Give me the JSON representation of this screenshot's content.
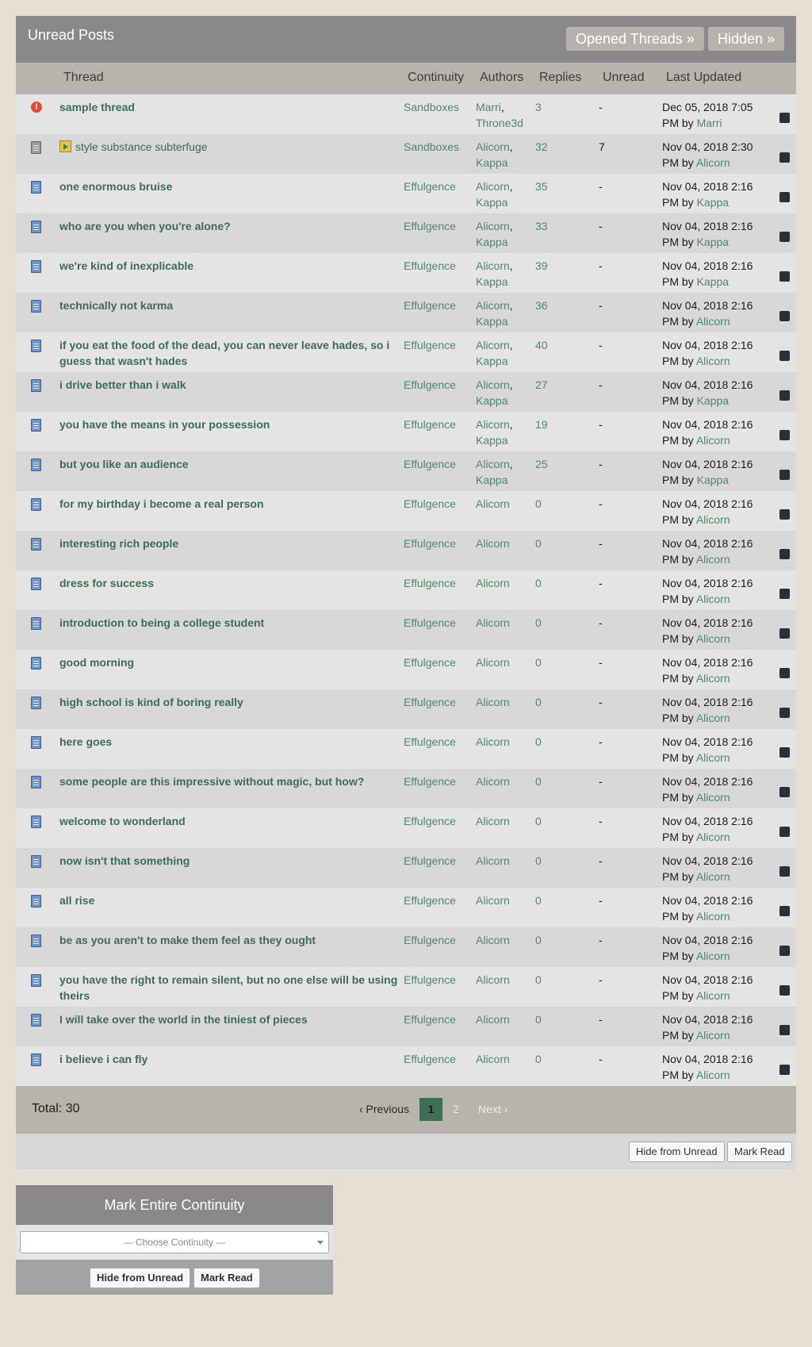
{
  "header": {
    "title": "Unread Posts",
    "opened_threads_label": "Opened Threads »",
    "hidden_label": "Hidden »"
  },
  "columns": {
    "thread": "Thread",
    "continuity": "Continuity",
    "authors": "Authors",
    "replies": "Replies",
    "unread": "Unread",
    "last_updated": "Last Updated"
  },
  "rows": [
    {
      "icon": "alert-icon",
      "title": "sample thread",
      "continuity": "Sandboxes",
      "authors": [
        "Marri",
        "Throne3d"
      ],
      "replies": "3",
      "unread": "-",
      "updated": "Dec 05, 2018 7:05 PM by",
      "by": "Marri"
    },
    {
      "icon": "grey-book-icon",
      "title": "style substance subterfuge",
      "plain": true,
      "reply_icon": true,
      "continuity": "Sandboxes",
      "authors": [
        "Alicorn",
        "Kappa"
      ],
      "replies": "32",
      "unread": "7",
      "updated": "Nov 04, 2018 2:30 PM by",
      "by": "Alicorn"
    },
    {
      "icon": "book-icon",
      "title": "one enormous bruise",
      "continuity": "Effulgence",
      "authors": [
        "Alicorn",
        "Kappa"
      ],
      "replies": "35",
      "unread": "-",
      "updated": "Nov 04, 2018 2:16 PM by",
      "by": "Kappa"
    },
    {
      "icon": "book-icon",
      "title": "who are you when you're alone?",
      "continuity": "Effulgence",
      "authors": [
        "Alicorn",
        "Kappa"
      ],
      "replies": "33",
      "unread": "-",
      "updated": "Nov 04, 2018 2:16 PM by",
      "by": "Kappa"
    },
    {
      "icon": "book-icon",
      "title": "we're kind of inexplicable",
      "continuity": "Effulgence",
      "authors": [
        "Alicorn",
        "Kappa"
      ],
      "replies": "39",
      "unread": "-",
      "updated": "Nov 04, 2018 2:16 PM by",
      "by": "Kappa"
    },
    {
      "icon": "book-icon",
      "title": "technically not karma",
      "continuity": "Effulgence",
      "authors": [
        "Alicorn",
        "Kappa"
      ],
      "replies": "36",
      "unread": "-",
      "updated": "Nov 04, 2018 2:16 PM by",
      "by": "Alicorn"
    },
    {
      "icon": "book-icon",
      "title": "if you eat the food of the dead, you can never leave hades, so i guess that wasn't hades",
      "continuity": "Effulgence",
      "authors": [
        "Alicorn",
        "Kappa"
      ],
      "replies": "40",
      "unread": "-",
      "updated": "Nov 04, 2018 2:16 PM by",
      "by": "Alicorn"
    },
    {
      "icon": "book-icon",
      "title": "i drive better than i walk",
      "continuity": "Effulgence",
      "authors": [
        "Alicorn",
        "Kappa"
      ],
      "replies": "27",
      "unread": "-",
      "updated": "Nov 04, 2018 2:16 PM by",
      "by": "Kappa"
    },
    {
      "icon": "book-icon",
      "title": "you have the means in your possession",
      "continuity": "Effulgence",
      "authors": [
        "Alicorn",
        "Kappa"
      ],
      "replies": "19",
      "unread": "-",
      "updated": "Nov 04, 2018 2:16 PM by",
      "by": "Alicorn"
    },
    {
      "icon": "book-icon",
      "title": "but you like an audience",
      "continuity": "Effulgence",
      "authors": [
        "Alicorn",
        "Kappa"
      ],
      "replies": "25",
      "unread": "-",
      "updated": "Nov 04, 2018 2:16 PM by",
      "by": "Kappa"
    },
    {
      "icon": "book-icon",
      "title": "for my birthday i become a real person",
      "continuity": "Effulgence",
      "authors": [
        "Alicorn"
      ],
      "replies": "0",
      "unread": "-",
      "updated": "Nov 04, 2018 2:16 PM by",
      "by": "Alicorn"
    },
    {
      "icon": "book-icon",
      "title": "interesting rich people",
      "continuity": "Effulgence",
      "authors": [
        "Alicorn"
      ],
      "replies": "0",
      "unread": "-",
      "updated": "Nov 04, 2018 2:16 PM by",
      "by": "Alicorn"
    },
    {
      "icon": "book-icon",
      "title": "dress for success",
      "continuity": "Effulgence",
      "authors": [
        "Alicorn"
      ],
      "replies": "0",
      "unread": "-",
      "updated": "Nov 04, 2018 2:16 PM by",
      "by": "Alicorn"
    },
    {
      "icon": "book-icon",
      "title": "introduction to being a college student",
      "continuity": "Effulgence",
      "authors": [
        "Alicorn"
      ],
      "replies": "0",
      "unread": "-",
      "updated": "Nov 04, 2018 2:16 PM by",
      "by": "Alicorn"
    },
    {
      "icon": "book-icon",
      "title": "good morning",
      "continuity": "Effulgence",
      "authors": [
        "Alicorn"
      ],
      "replies": "0",
      "unread": "-",
      "updated": "Nov 04, 2018 2:16 PM by",
      "by": "Alicorn"
    },
    {
      "icon": "book-icon",
      "title": "high school is kind of boring really",
      "continuity": "Effulgence",
      "authors": [
        "Alicorn"
      ],
      "replies": "0",
      "unread": "-",
      "updated": "Nov 04, 2018 2:16 PM by",
      "by": "Alicorn"
    },
    {
      "icon": "book-icon",
      "title": "here goes",
      "continuity": "Effulgence",
      "authors": [
        "Alicorn"
      ],
      "replies": "0",
      "unread": "-",
      "updated": "Nov 04, 2018 2:16 PM by",
      "by": "Alicorn"
    },
    {
      "icon": "book-icon",
      "title": "some people are this impressive without magic, but how?",
      "continuity": "Effulgence",
      "authors": [
        "Alicorn"
      ],
      "replies": "0",
      "unread": "-",
      "updated": "Nov 04, 2018 2:16 PM by",
      "by": "Alicorn"
    },
    {
      "icon": "book-icon",
      "title": "welcome to wonderland",
      "continuity": "Effulgence",
      "authors": [
        "Alicorn"
      ],
      "replies": "0",
      "unread": "-",
      "updated": "Nov 04, 2018 2:16 PM by",
      "by": "Alicorn"
    },
    {
      "icon": "book-icon",
      "title": "now isn't that something",
      "continuity": "Effulgence",
      "authors": [
        "Alicorn"
      ],
      "replies": "0",
      "unread": "-",
      "updated": "Nov 04, 2018 2:16 PM by",
      "by": "Alicorn"
    },
    {
      "icon": "book-icon",
      "title": "all rise",
      "continuity": "Effulgence",
      "authors": [
        "Alicorn"
      ],
      "replies": "0",
      "unread": "-",
      "updated": "Nov 04, 2018 2:16 PM by",
      "by": "Alicorn"
    },
    {
      "icon": "book-icon",
      "title": "be as you aren't to make them feel as they ought",
      "continuity": "Effulgence",
      "authors": [
        "Alicorn"
      ],
      "replies": "0",
      "unread": "-",
      "updated": "Nov 04, 2018 2:16 PM by",
      "by": "Alicorn"
    },
    {
      "icon": "book-icon",
      "title": "you have the right to remain silent, but no one else will be using theirs",
      "continuity": "Effulgence",
      "authors": [
        "Alicorn"
      ],
      "replies": "0",
      "unread": "-",
      "updated": "Nov 04, 2018 2:16 PM by",
      "by": "Alicorn"
    },
    {
      "icon": "book-icon",
      "title": "I will take over the world in the tiniest of pieces",
      "continuity": "Effulgence",
      "authors": [
        "Alicorn"
      ],
      "replies": "0",
      "unread": "-",
      "updated": "Nov 04, 2018 2:16 PM by",
      "by": "Alicorn"
    },
    {
      "icon": "book-icon",
      "title": "i believe i can fly",
      "continuity": "Effulgence",
      "authors": [
        "Alicorn"
      ],
      "replies": "0",
      "unread": "-",
      "updated": "Nov 04, 2018 2:16 PM by",
      "by": "Alicorn"
    }
  ],
  "footer": {
    "total": "Total: 30",
    "previous": "‹ Previous",
    "page_1": "1",
    "page_2": "2",
    "next": "Next ›"
  },
  "actions": {
    "hide_from_unread": "Hide from Unread",
    "mark_read": "Mark Read"
  },
  "mark_continuity": {
    "title": "Mark Entire Continuity",
    "select_placeholder": "— Choose Continuity —",
    "hide_from_unread": "Hide from Unread",
    "mark_read": "Mark Read"
  },
  "colors": {
    "link": "#4f8a69",
    "thread_title": "#3d6e53",
    "header_bg": "#8a8888",
    "current_page": "#3e6e55"
  }
}
